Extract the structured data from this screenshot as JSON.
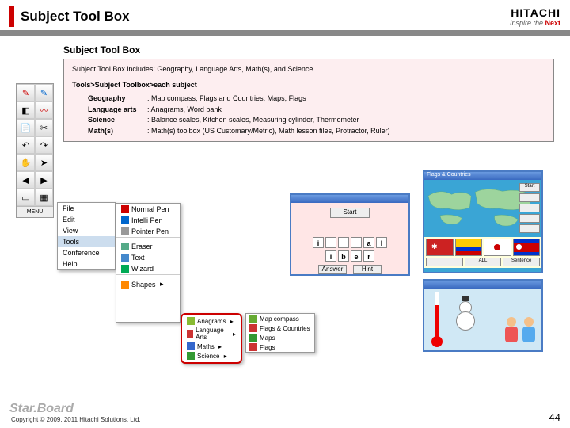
{
  "header": {
    "title": "Subject Tool Box",
    "logo_name": "HITACHI",
    "logo_tag_a": "Inspire the ",
    "logo_tag_b": "Next"
  },
  "section": {
    "title": "Subject Tool Box",
    "includes": "Subject Tool Box includes: Geography, Language Arts, Math(s), and Science",
    "nav": "Tools>Subject Toolbox>each subject"
  },
  "subjects": [
    {
      "name": "Geography",
      "desc": ": Map compass, Flags and Countries, Maps, Flags"
    },
    {
      "name": "Language arts",
      "desc": ": Anagrams, Word bank"
    },
    {
      "name": "Science",
      "desc": ": Balance scales, Kitchen scales, Measuring cylinder, Thermometer"
    },
    {
      "name": "Math(s)",
      "desc": ": Math(s) toolbox (US Customary/Metric), Math lesson files, Protractor, Ruler)"
    }
  ],
  "menu1": [
    "File",
    "Edit",
    "View",
    "Tools",
    "Conference",
    "Help"
  ],
  "menu2": [
    "Normal Pen",
    "Intelli Pen",
    "Pointer Pen",
    "Eraser",
    "Text",
    "Wizard",
    "Shapes"
  ],
  "menu3": [
    "Anagrams",
    "Language Arts",
    "Maths",
    "Science"
  ],
  "menu4": [
    "Map compass",
    "Flags & Countries",
    "Maps",
    "Flags"
  ],
  "win1": {
    "start": "Start",
    "ans": "Answer",
    "hint": "Hint",
    "r1": [
      "i",
      "",
      "",
      "",
      "a",
      "l"
    ],
    "r2": [
      "i",
      "b",
      "e",
      "r"
    ]
  },
  "win2": {
    "title": "Flags & Countries",
    "side": [
      "Start",
      "",
      "",
      "",
      ""
    ],
    "foot": [
      "",
      "ALL",
      "Sentence"
    ]
  },
  "footer": {
    "brand": "Star.Board",
    "copy": "Copyright © 2009, 2011 Hitachi Solutions, Ltd.",
    "page": "44"
  },
  "colors": {
    "red": "#c00",
    "blue": "#4a7bc4"
  }
}
